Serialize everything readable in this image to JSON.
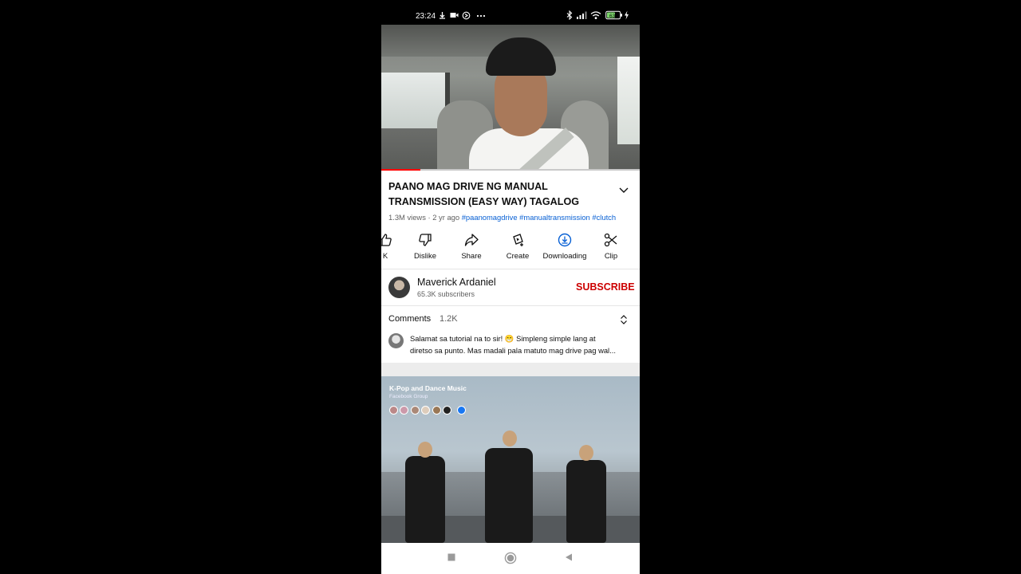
{
  "status_bar": {
    "time": "23:24",
    "left_icons": [
      "download-icon",
      "video-record-icon",
      "do-not-disturb-icon",
      "more-dots-icon"
    ],
    "right_icons": [
      "bluetooth-icon",
      "signal-icon",
      "wifi-icon",
      "battery-icon",
      "charging-icon"
    ],
    "battery_level": "63"
  },
  "video": {
    "title": "PAANO MAG DRIVE NG MANUAL TRANSMISSION (EASY WAY) TAGALOG",
    "views": "1.3M views",
    "age": "2 yr ago",
    "hashtags": [
      "#paanomagdrive",
      "#manualtransmission",
      "#clutch"
    ],
    "progress_fraction": 0.15
  },
  "actions": [
    {
      "label": "K",
      "icon": "like-icon"
    },
    {
      "label": "Dislike",
      "icon": "dislike-icon"
    },
    {
      "label": "Share",
      "icon": "share-icon"
    },
    {
      "label": "Create",
      "icon": "create-icon"
    },
    {
      "label": "Downloading",
      "icon": "downloading-icon"
    },
    {
      "label": "Clip",
      "icon": "scissors-icon"
    }
  ],
  "channel": {
    "name": "Maverick Ardaniel",
    "subscribers": "65.3K subscribers",
    "subscribe_label": "SUBSCRIBE"
  },
  "comments": {
    "label": "Comments",
    "count": "1.2K",
    "top_comment_line1": "Salamat sa tutorial na to sir! 😁 Simpleng simple lang at",
    "top_comment_line2": "diretso sa punto. Mas madali pala matuto mag drive pag wal..."
  },
  "next_video": {
    "overlay_title": "K-Pop and Dance Music",
    "overlay_subtitle": "Facebook Group"
  },
  "colors": {
    "subscribe": "#cc0000",
    "hashtag": "#065fd4",
    "progress": "#ff0000",
    "download_accent": "#065fd4"
  }
}
